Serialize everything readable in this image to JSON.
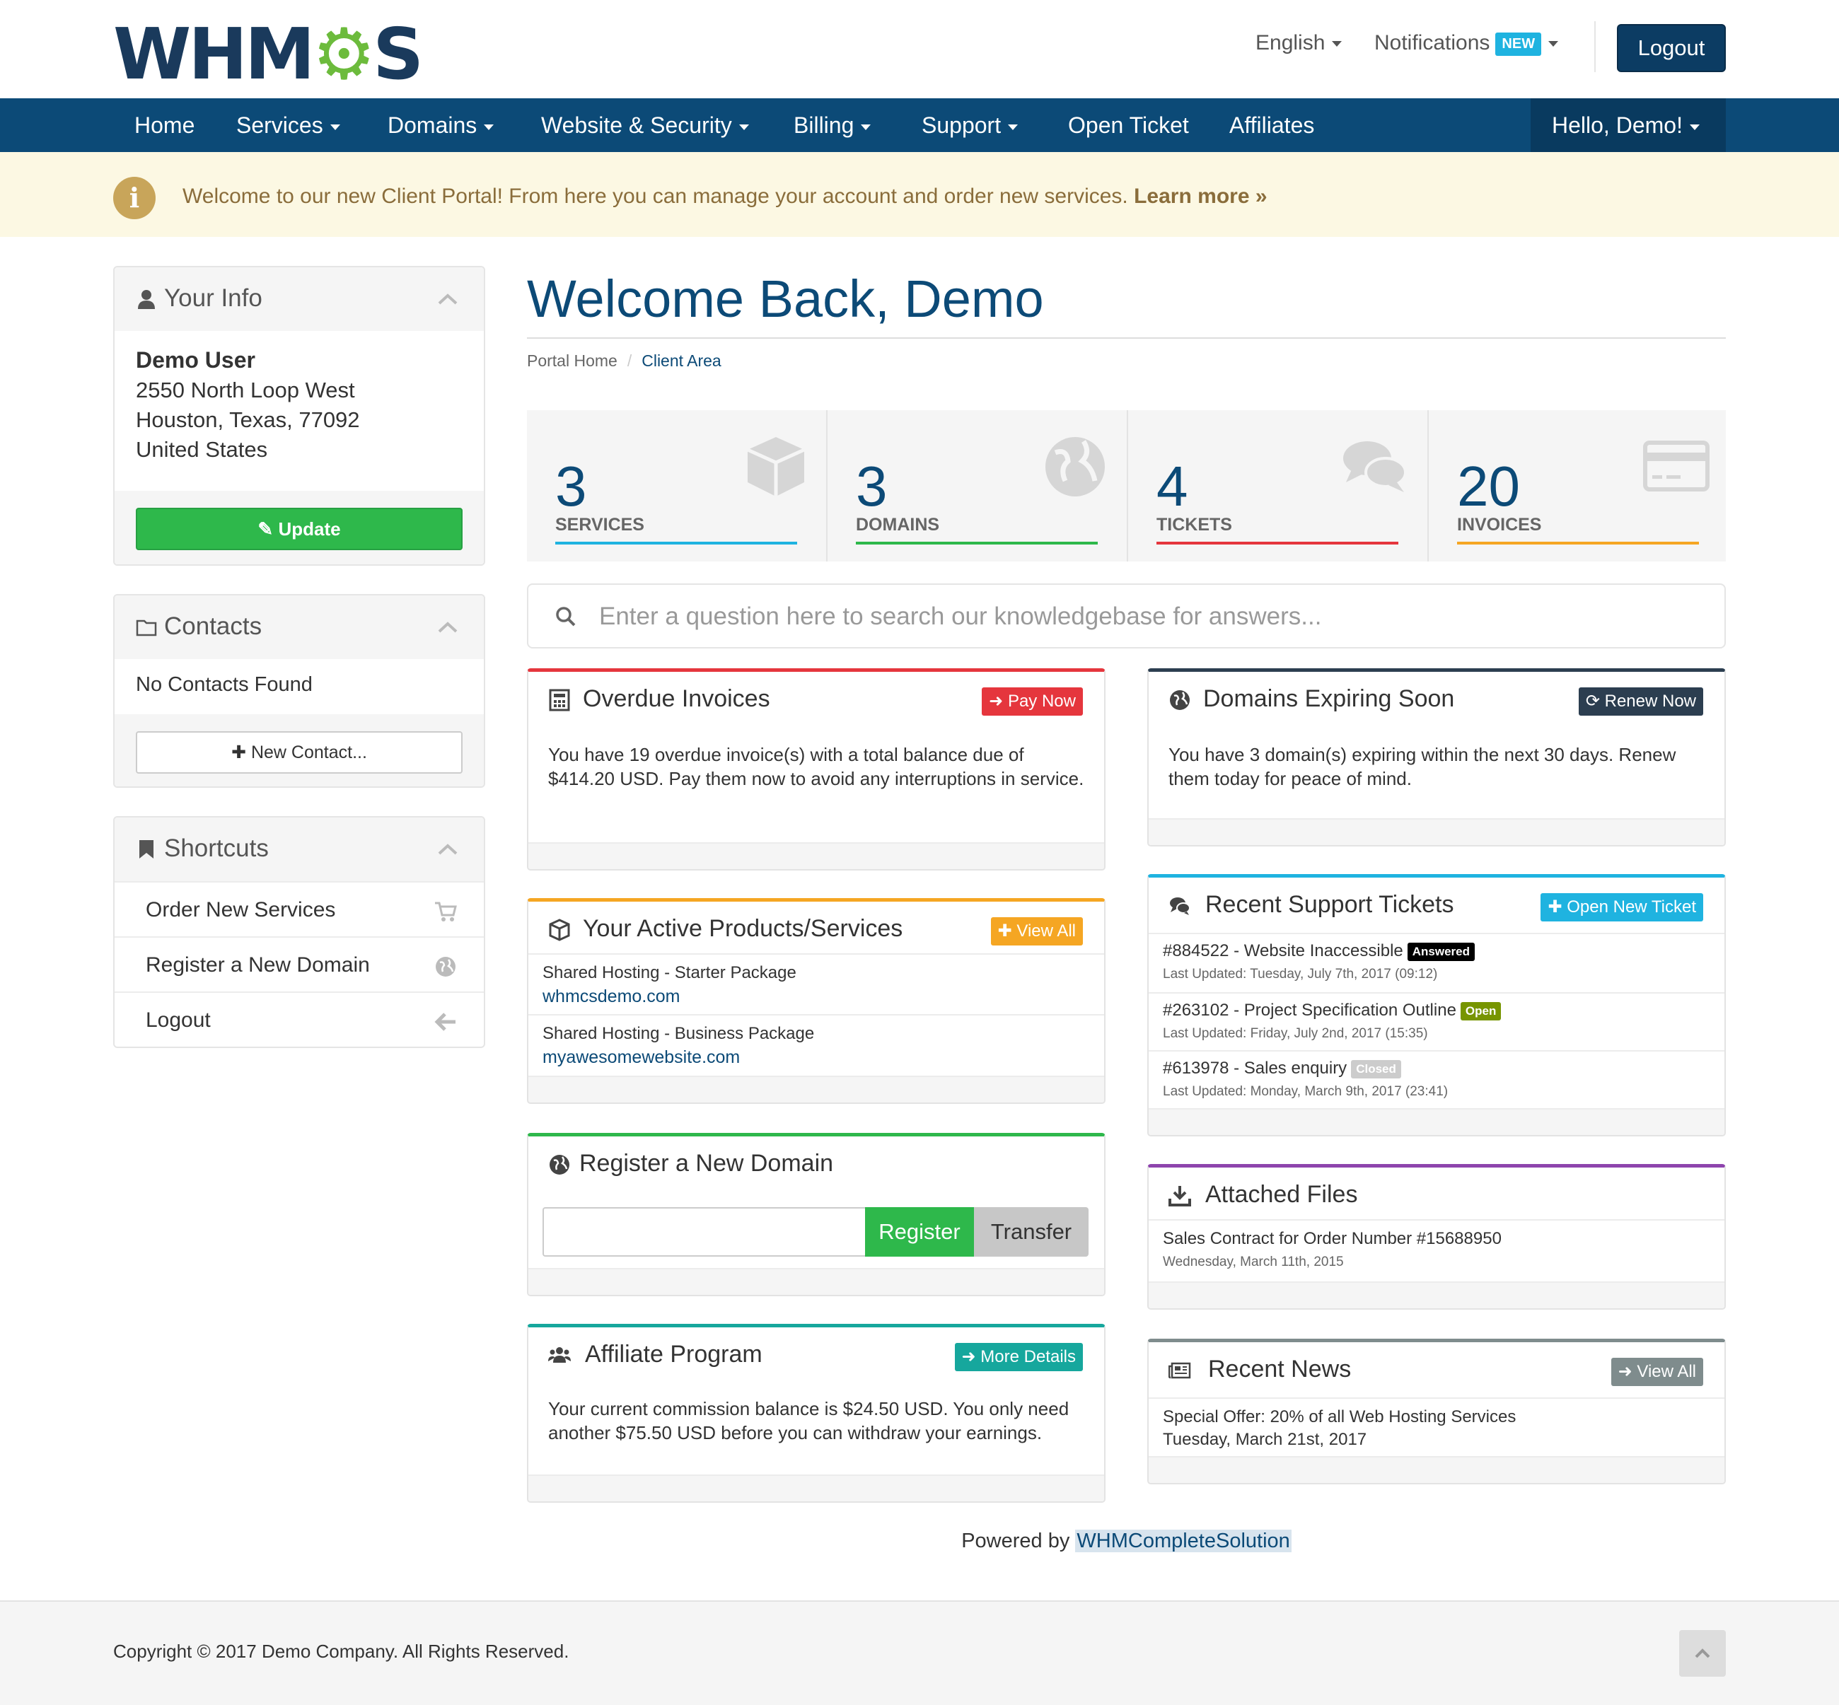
{
  "header": {
    "logo": "WHMCS",
    "language": "English",
    "notifications_label": "Notifications",
    "notifications_badge": "NEW",
    "logout_label": "Logout"
  },
  "nav": {
    "items": [
      "Home",
      "Services",
      "Domains",
      "Website & Security",
      "Billing",
      "Support",
      "Open Ticket",
      "Affiliates"
    ],
    "hello": "Hello, Demo!"
  },
  "alert": {
    "text": "Welcome to our new Client Portal! From here you can manage your account and order new services.",
    "link": "Learn more »"
  },
  "sidebar": {
    "your_info": {
      "title": "Your Info",
      "name": "Demo User",
      "address1": "2550 North Loop West",
      "address2": "Houston, Texas, 77092",
      "country": "United States",
      "update_label": "Update"
    },
    "contacts": {
      "title": "Contacts",
      "empty": "No Contacts Found",
      "new_label": "New Contact..."
    },
    "shortcuts": {
      "title": "Shortcuts",
      "items": [
        "Order New Services",
        "Register a New Domain",
        "Logout"
      ]
    }
  },
  "main": {
    "title": "Welcome Back, Demo",
    "breadcrumb": [
      "Portal Home",
      "Client Area"
    ],
    "stats": [
      {
        "value": "3",
        "label": "SERVICES",
        "color": "#1fb3e0"
      },
      {
        "value": "3",
        "label": "DOMAINS",
        "color": "#2eb84b"
      },
      {
        "value": "4",
        "label": "TICKETS",
        "color": "#e5363d"
      },
      {
        "value": "20",
        "label": "INVOICES",
        "color": "#f5a623"
      }
    ],
    "search_placeholder": "Enter a question here to search our knowledgebase for answers..."
  },
  "cards": {
    "overdue": {
      "title": "Overdue Invoices",
      "button": "Pay Now",
      "text": "You have 19 overdue invoice(s) with a total balance due of $414.20 USD. Pay them now to avoid any interruptions in service.",
      "color": "#e5363d"
    },
    "domains_expiring": {
      "title": "Domains Expiring Soon",
      "button": "Renew Now",
      "text": "You have 3 domain(s) expiring within the next 30 days. Renew them today for peace of mind.",
      "color": "#2c3e50"
    },
    "products": {
      "title": "Your Active Products/Services",
      "button": "View All",
      "color": "#f5a623",
      "items": [
        {
          "name": "Shared Hosting - Starter Package",
          "domain": "whmcsdemo.com"
        },
        {
          "name": "Shared Hosting - Business Package",
          "domain": "myawesomewebsite.com"
        }
      ]
    },
    "tickets": {
      "title": "Recent Support Tickets",
      "button": "Open New Ticket",
      "color": "#1fb3e0",
      "items": [
        {
          "subject": "#884522 - Website Inaccessible",
          "status": "Answered",
          "status_color": "#000000",
          "updated": "Last Updated: Tuesday, July 7th, 2017 (09:12)"
        },
        {
          "subject": "#263102 - Project Specification Outline",
          "status": "Open",
          "status_color": "#779500",
          "updated": "Last Updated: Friday, July 2nd, 2017 (15:35)"
        },
        {
          "subject": "#613978 - Sales enquiry",
          "status": "Closed",
          "status_color": "#cccccc",
          "updated": "Last Updated: Monday, March 9th, 2017 (23:41)"
        }
      ]
    },
    "register_domain": {
      "title": "Register a New Domain",
      "register_label": "Register",
      "transfer_label": "Transfer",
      "color": "#2eb84b"
    },
    "attached_files": {
      "title": "Attached Files",
      "color": "#8e44ad",
      "file_name": "Sales Contract for Order Number #15688950",
      "file_date": "Wednesday, March 11th, 2015"
    },
    "affiliate": {
      "title": "Affiliate Program",
      "button": "More Details",
      "color": "#16a79d",
      "text": "Your current commission balance is $24.50 USD. You only need another $75.50 USD before you can withdraw your earnings."
    },
    "news": {
      "title": "Recent News",
      "button": "View All",
      "color": "#7f8c8d",
      "headline": "Special Offer: 20% of all Web Hosting Services",
      "date": "Tuesday, March 21st, 2017"
    }
  },
  "footer": {
    "powered_prefix": "Powered by",
    "powered_link": "WHMCompleteSolution",
    "copyright": "Copyright © 2017 Demo Company. All Rights Reserved."
  }
}
